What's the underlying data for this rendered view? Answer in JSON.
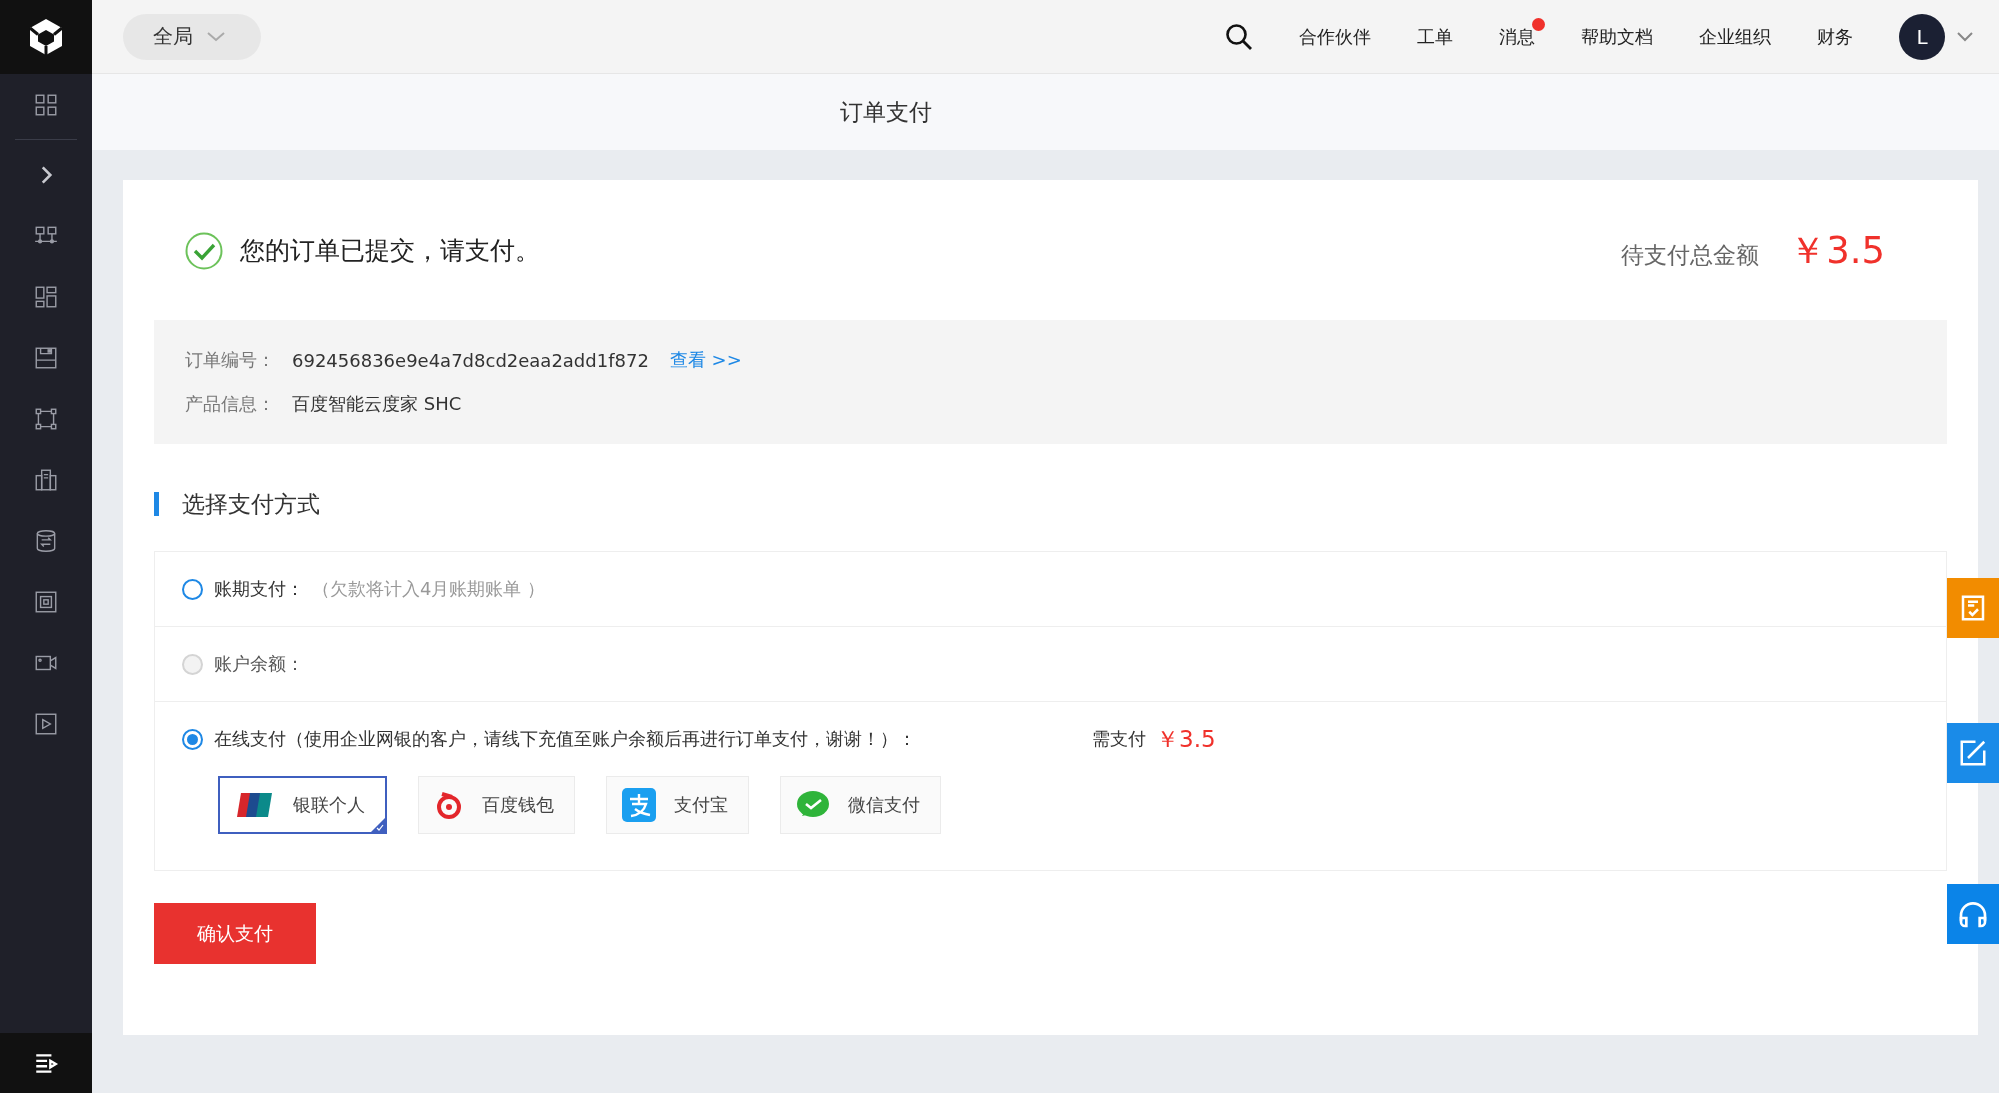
{
  "topbar": {
    "scope": "全局",
    "nav": [
      {
        "label": "合作伙伴",
        "badge": false
      },
      {
        "label": "工单",
        "badge": false
      },
      {
        "label": "消息",
        "badge": true
      },
      {
        "label": "帮助文档",
        "badge": false
      },
      {
        "label": "企业组织",
        "badge": false
      },
      {
        "label": "财务",
        "badge": false
      }
    ],
    "avatar": "L"
  },
  "page_title": "订单支付",
  "notice": "您的订单已提交，请支付。",
  "total": {
    "label": "待支付总金额",
    "amount": "￥3.5"
  },
  "order_info": [
    {
      "label": "订单编号：",
      "value": "692456836e9e4a7d8cd2eaa2add1f872",
      "link": "查看 >>"
    },
    {
      "label": "产品信息：",
      "value": "百度智能云度家 SHC"
    }
  ],
  "section_title": "选择支付方式",
  "payment_options": [
    {
      "label": "账期支付：",
      "note": "（欠款将计入4月账期账单 ）",
      "selected": false,
      "disabled": false
    },
    {
      "label": "账户余额：",
      "selected": false,
      "disabled": true
    },
    {
      "label": "在线支付（使用企业网银的客户，请线下充值至账户余额后再进行订单支付，谢谢！）：",
      "selected": true,
      "disabled": false,
      "due_label": "需支付",
      "due_amount": "￥3.5",
      "channels": [
        {
          "label": "银联个人",
          "kind": "unionpay",
          "selected": true
        },
        {
          "label": "百度钱包",
          "kind": "baidu",
          "selected": false
        },
        {
          "label": "支付宝",
          "kind": "alipay",
          "selected": false
        },
        {
          "label": "微信支付",
          "kind": "wechat",
          "selected": false
        }
      ]
    }
  ],
  "confirm_button": "确认支付"
}
